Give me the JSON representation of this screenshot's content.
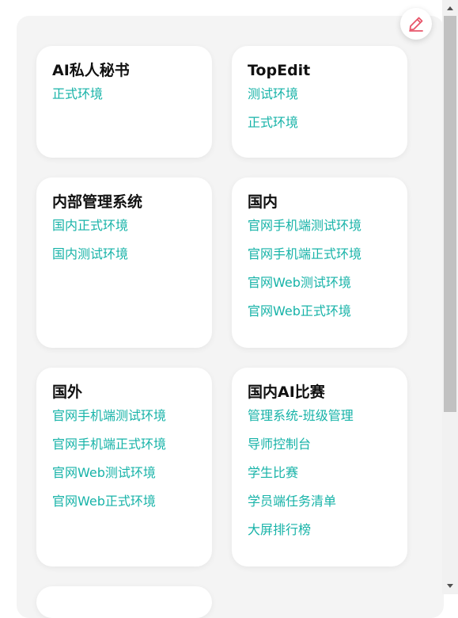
{
  "edit_button": {
    "icon": "pencil-icon",
    "color": "#e8566b"
  },
  "accent_link_color": "#17b3a8",
  "cards": [
    {
      "title": "AI私人秘书",
      "links": [
        "正式环境"
      ]
    },
    {
      "title": "TopEdit",
      "links": [
        "测试环境",
        "正式环境"
      ]
    },
    {
      "title": "内部管理系统",
      "links": [
        "国内正式环境",
        "国内测试环境"
      ]
    },
    {
      "title": "国内",
      "links": [
        "官网手机端测试环境",
        "官网手机端正式环境",
        "官网Web测试环境",
        "官网Web正式环境"
      ]
    },
    {
      "title": "国外",
      "links": [
        "官网手机端测试环境",
        "官网手机端正式环境",
        "官网Web测试环境",
        "官网Web正式环境"
      ]
    },
    {
      "title": "国内AI比赛",
      "links": [
        "管理系统-班级管理",
        "导师控制台",
        "学生比赛",
        "学员端任务清单",
        "大屏排行榜"
      ]
    }
  ]
}
